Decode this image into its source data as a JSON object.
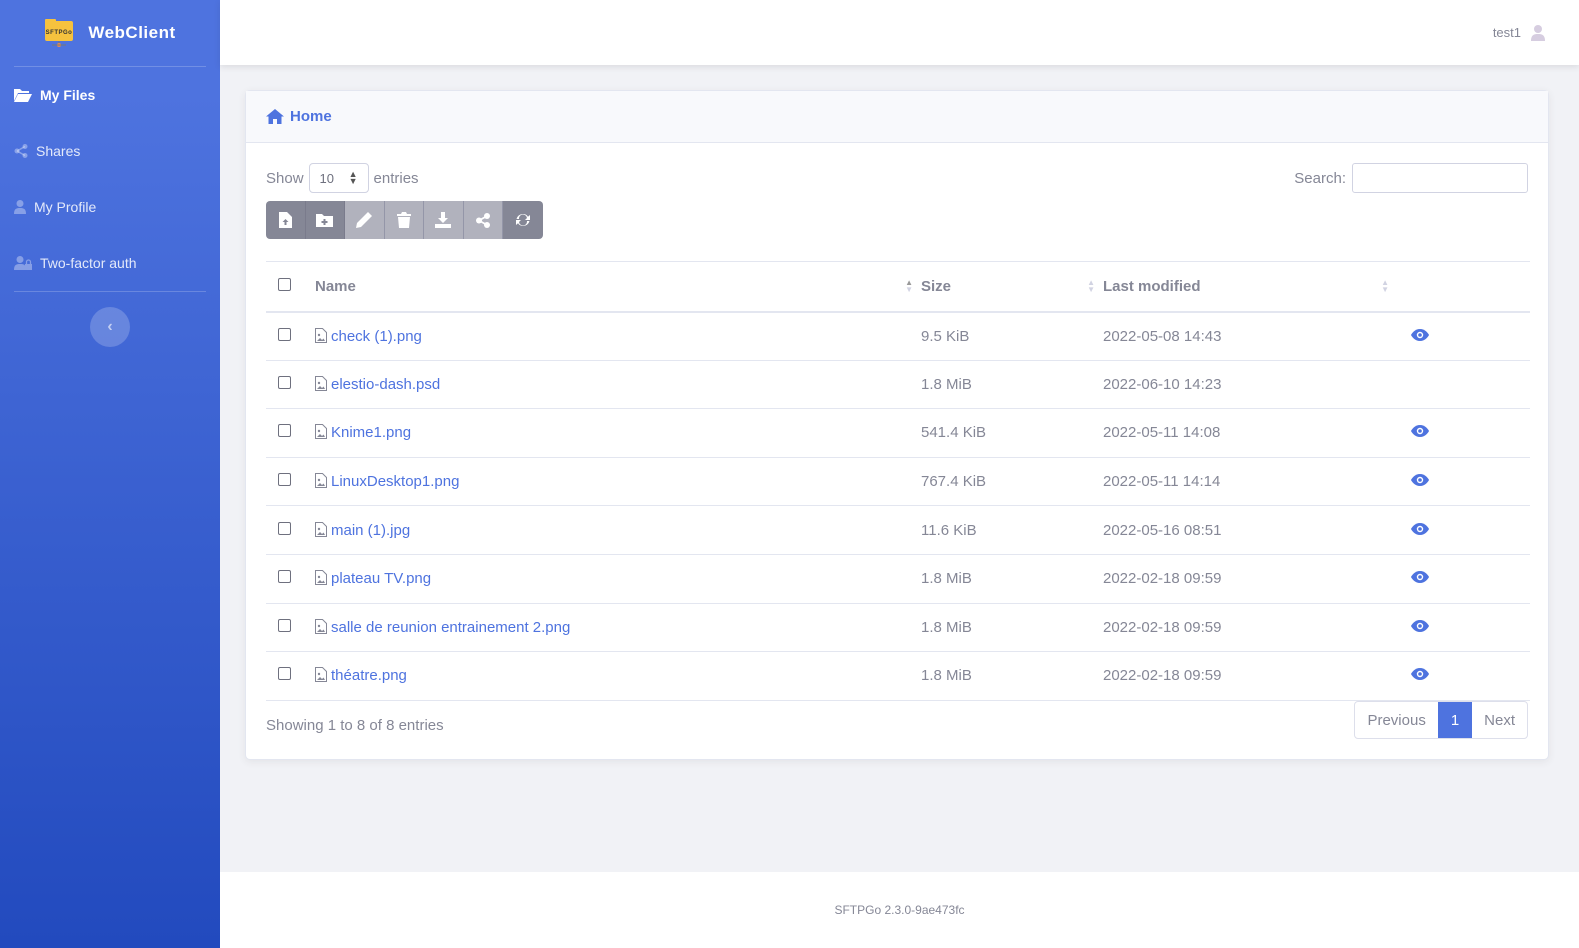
{
  "brand": {
    "name": "WebClient",
    "logo_text": "SFTPGo"
  },
  "sidebar": {
    "items": [
      {
        "label": "My Files",
        "icon": "folder-open-icon",
        "active": true
      },
      {
        "label": "Shares",
        "icon": "share-icon"
      },
      {
        "label": "My Profile",
        "icon": "user-icon"
      },
      {
        "label": "Two-factor auth",
        "icon": "user-lock-icon"
      }
    ]
  },
  "topbar": {
    "username": "test1"
  },
  "card": {
    "title": "Home"
  },
  "length": {
    "show": "Show",
    "value": "10",
    "entries": "entries"
  },
  "search": {
    "label": "Search:",
    "value": ""
  },
  "toolbar": [
    "upload-file-icon",
    "add-folder-icon",
    "rename-icon",
    "delete-icon",
    "download-icon",
    "share-icon",
    "refresh-icon"
  ],
  "table": {
    "columns": [
      "Name",
      "Size",
      "Last modified"
    ],
    "rows": [
      {
        "name": "check (1).png",
        "size": "9.5 KiB",
        "modified": "2022-05-08 14:43",
        "preview": true
      },
      {
        "name": "elestio-dash.psd",
        "size": "1.8 MiB",
        "modified": "2022-06-10 14:23",
        "preview": false
      },
      {
        "name": "Knime1.png",
        "size": "541.4 KiB",
        "modified": "2022-05-11 14:08",
        "preview": true
      },
      {
        "name": "LinuxDesktop1.png",
        "size": "767.4 KiB",
        "modified": "2022-05-11 14:14",
        "preview": true
      },
      {
        "name": "main (1).jpg",
        "size": "11.6 KiB",
        "modified": "2022-05-16 08:51",
        "preview": true
      },
      {
        "name": "plateau TV.png",
        "size": "1.8 MiB",
        "modified": "2022-02-18 09:59",
        "preview": true
      },
      {
        "name": "salle de reunion entrainement 2.png",
        "size": "1.8 MiB",
        "modified": "2022-02-18 09:59",
        "preview": true
      },
      {
        "name": "théatre.png",
        "size": "1.8 MiB",
        "modified": "2022-02-18 09:59",
        "preview": true
      }
    ]
  },
  "info": "Showing 1 to 8 of 8 entries",
  "pagination": {
    "previous": "Previous",
    "current": "1",
    "next": "Next"
  },
  "footer": "SFTPGo 2.3.0-9ae473fc",
  "colors": {
    "primary": "#4e73df",
    "sidebar_end": "#224abe",
    "muted": "#858796"
  }
}
